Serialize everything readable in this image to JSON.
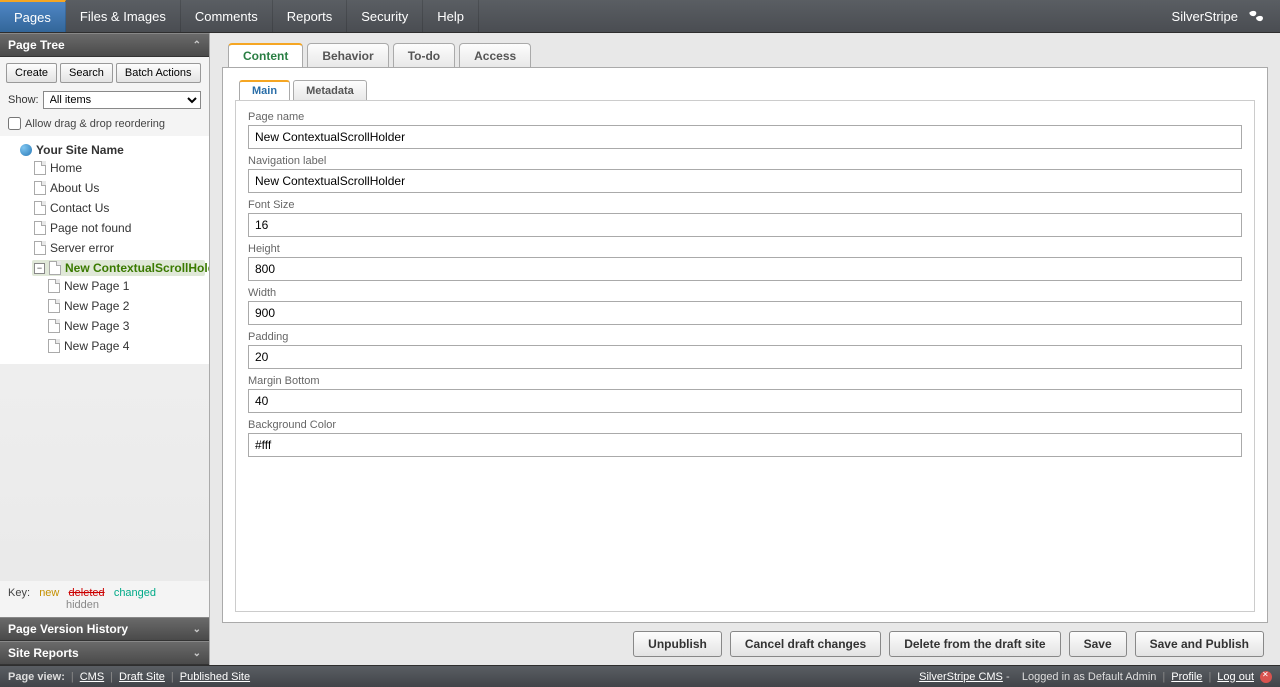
{
  "top_menu": {
    "items": [
      "Pages",
      "Files & Images",
      "Comments",
      "Reports",
      "Security",
      "Help"
    ],
    "active_index": 0,
    "brand": "SilverStripe"
  },
  "sidebar": {
    "panel_title": "Page Tree",
    "buttons": {
      "create": "Create",
      "search": "Search",
      "batch": "Batch Actions"
    },
    "show_label": "Show:",
    "show_value": "All items",
    "allow_drag_label": "Allow drag & drop reordering",
    "tree": {
      "root": "Your Site Name",
      "pages": [
        {
          "label": "Home"
        },
        {
          "label": "About Us"
        },
        {
          "label": "Contact Us"
        },
        {
          "label": "Page not found"
        },
        {
          "label": "Server error"
        },
        {
          "label": "New ContextualScrollHolder",
          "selected": true,
          "children": [
            {
              "label": "New Page 1"
            },
            {
              "label": "New Page 2"
            },
            {
              "label": "New Page 3"
            },
            {
              "label": "New Page 4"
            }
          ]
        }
      ]
    },
    "legend": {
      "key": "Key:",
      "new": "new",
      "deleted": "deleted",
      "changed": "changed",
      "hidden": "hidden"
    },
    "history_title": "Page Version History",
    "reports_title": "Site Reports"
  },
  "content": {
    "tabs": [
      "Content",
      "Behavior",
      "To-do",
      "Access"
    ],
    "active_tab": 0,
    "subtabs": [
      "Main",
      "Metadata"
    ],
    "active_subtab": 0,
    "fields": [
      {
        "label": "Page name",
        "value": "New ContextualScrollHolder"
      },
      {
        "label": "Navigation label",
        "value": "New ContextualScrollHolder"
      },
      {
        "label": "Font Size",
        "value": "16"
      },
      {
        "label": "Height",
        "value": "800"
      },
      {
        "label": "Width",
        "value": "900"
      },
      {
        "label": "Padding",
        "value": "20"
      },
      {
        "label": "Margin Bottom",
        "value": "40"
      },
      {
        "label": "Background Color",
        "value": "#fff"
      }
    ],
    "actions": {
      "unpublish": "Unpublish",
      "cancel_draft": "Cancel draft changes",
      "delete_draft": "Delete from the draft site",
      "save": "Save",
      "save_publish": "Save and Publish"
    }
  },
  "status": {
    "page_view": "Page view:",
    "cms": "CMS",
    "draft": "Draft Site",
    "published": "Published Site",
    "product": "SilverStripe CMS",
    "dash": "-",
    "logged_in": "Logged in as Default Admin",
    "profile": "Profile",
    "logout": "Log out"
  }
}
